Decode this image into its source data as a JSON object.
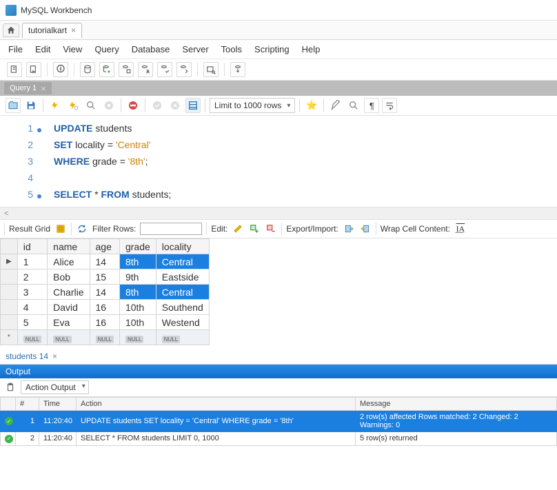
{
  "window": {
    "title": "MySQL Workbench"
  },
  "connection_tab": {
    "label": "tutorialkart"
  },
  "menu": [
    "File",
    "Edit",
    "View",
    "Query",
    "Database",
    "Server",
    "Tools",
    "Scripting",
    "Help"
  ],
  "query_tab": {
    "label": "Query 1"
  },
  "editor_toolbar": {
    "limit_label": "Limit to 1000 rows"
  },
  "sql": {
    "lines": [
      {
        "n": "1",
        "dot": true,
        "tokens": [
          [
            "kw",
            "UPDATE"
          ],
          [
            "",
            " students"
          ]
        ]
      },
      {
        "n": "2",
        "dot": false,
        "tokens": [
          [
            "kw",
            "SET"
          ],
          [
            "",
            " locality "
          ],
          [
            "punc",
            "="
          ],
          [
            "",
            " "
          ],
          [
            "str",
            "'Central'"
          ]
        ]
      },
      {
        "n": "3",
        "dot": false,
        "tokens": [
          [
            "kw",
            "WHERE"
          ],
          [
            "",
            " grade "
          ],
          [
            "punc",
            "="
          ],
          [
            "",
            " "
          ],
          [
            "str",
            "'8th'"
          ],
          [
            "punc",
            ";"
          ]
        ]
      },
      {
        "n": "4",
        "dot": false,
        "tokens": []
      },
      {
        "n": "5",
        "dot": true,
        "tokens": [
          [
            "kw",
            "SELECT"
          ],
          [
            "",
            " "
          ],
          [
            "punc",
            "*"
          ],
          [
            "",
            " "
          ],
          [
            "kw",
            "FROM"
          ],
          [
            "",
            " students"
          ],
          [
            "punc",
            ";"
          ]
        ]
      }
    ]
  },
  "result_toolbar": {
    "grid_label": "Result Grid",
    "filter_label": "Filter Rows:",
    "edit_label": "Edit:",
    "export_label": "Export/Import:",
    "wrap_label": "Wrap Cell Content:"
  },
  "result": {
    "columns": [
      "id",
      "name",
      "age",
      "grade",
      "locality"
    ],
    "rows": [
      {
        "cells": [
          "1",
          "Alice",
          "14",
          "8th",
          "Central"
        ],
        "hl": [
          3,
          4
        ]
      },
      {
        "cells": [
          "2",
          "Bob",
          "15",
          "9th",
          "Eastside"
        ],
        "hl": []
      },
      {
        "cells": [
          "3",
          "Charlie",
          "14",
          "8th",
          "Central"
        ],
        "hl": [
          3,
          4
        ]
      },
      {
        "cells": [
          "4",
          "David",
          "16",
          "10th",
          "Southend"
        ],
        "hl": []
      },
      {
        "cells": [
          "5",
          "Eva",
          "16",
          "10th",
          "Westend"
        ],
        "hl": []
      }
    ]
  },
  "result_tab": {
    "label": "students 14"
  },
  "output": {
    "header": "Output",
    "combo": "Action Output",
    "columns": [
      "#",
      "Time",
      "Action",
      "Message"
    ],
    "rows": [
      {
        "sel": true,
        "num": "1",
        "time": "11:20:40",
        "action": "UPDATE students SET locality = 'Central' WHERE grade = '8th'",
        "message": "2 row(s) affected Rows matched: 2  Changed: 2  Warnings: 0"
      },
      {
        "sel": false,
        "num": "2",
        "time": "11:20:40",
        "action": "SELECT * FROM students LIMIT 0, 1000",
        "message": "5 row(s) returned"
      }
    ]
  }
}
